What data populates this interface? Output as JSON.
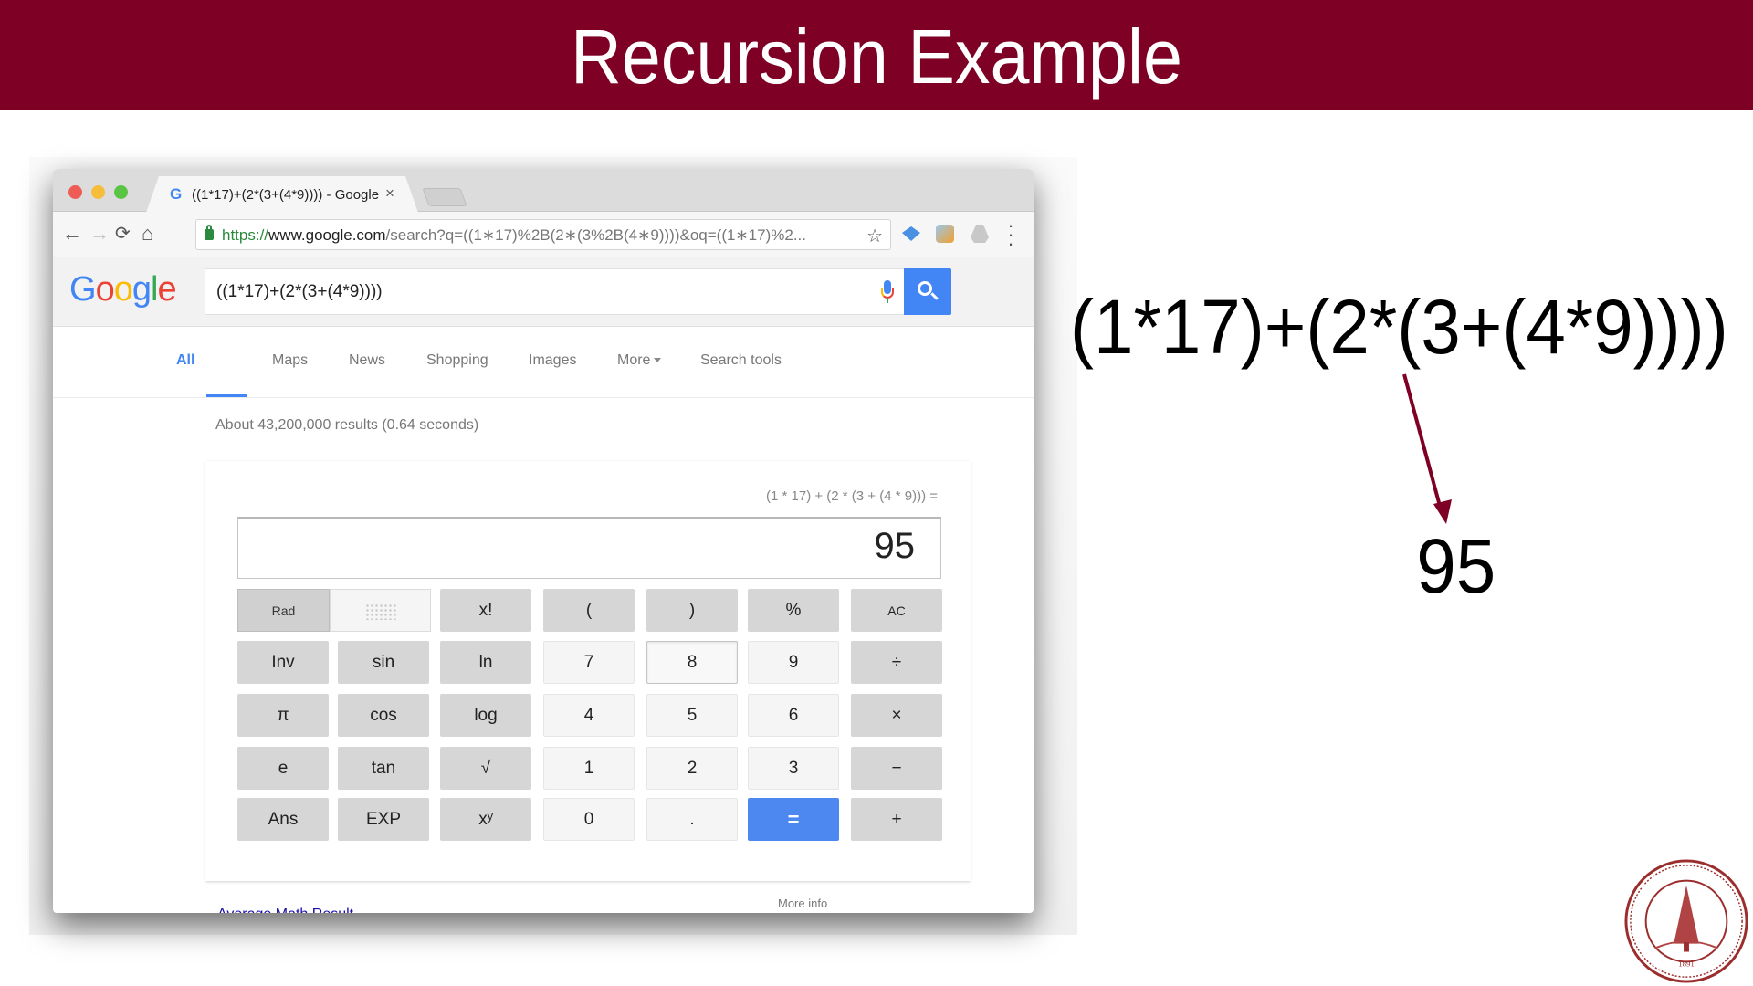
{
  "slide": {
    "title": "Recursion Example",
    "accent_color": "#7e0025"
  },
  "browser": {
    "tab": {
      "favicon": "G",
      "title": "((1*17)+(2*(3+(4*9)))) - Google S",
      "close": "×"
    },
    "toolbar": {
      "back": "←",
      "forward": "→",
      "reload": "⟳",
      "home": "⌂",
      "url_scheme": "https://",
      "url_host": "www.google.com",
      "url_path": "/search?q=((1∗17)%2B(2∗(3%2B(4∗9))))&oq=((1∗17)%2...",
      "star": "☆",
      "menu": "⋮",
      "extensions": [
        "graduation-cap-extension",
        "globe-extension",
        "drive-extension"
      ]
    }
  },
  "google": {
    "logo": [
      "G",
      "o",
      "o",
      "g",
      "l",
      "e"
    ],
    "query": "((1*17)+(2*(3+(4*9))))",
    "nav": [
      {
        "label": "All",
        "active": true
      },
      {
        "label": "Maps"
      },
      {
        "label": "News"
      },
      {
        "label": "Shopping"
      },
      {
        "label": "Images"
      },
      {
        "label": "More"
      },
      {
        "label": "Search tools"
      }
    ],
    "result_stats": "About 43,200,000 results (0.64 seconds)",
    "calculator": {
      "expression": "(1 * 17) + (2 * (3 + (4 * 9))) =",
      "result": "95",
      "angle_mode": "Rad",
      "keys": [
        [
          "x!",
          "(",
          ")",
          "%",
          "AC"
        ],
        [
          "Inv",
          "sin",
          "ln",
          "7",
          "8",
          "9",
          "÷"
        ],
        [
          "π",
          "cos",
          "log",
          "4",
          "5",
          "6",
          "×"
        ],
        [
          "e",
          "tan",
          "√",
          "1",
          "2",
          "3",
          "−"
        ],
        [
          "Ans",
          "EXP",
          "xʸ",
          "0",
          ".",
          "=",
          "+"
        ]
      ],
      "more_info": "More info"
    },
    "partial_link": "Average Math Result"
  },
  "annotation": {
    "equation": "(1*17)+(2*(3+(4*9))))",
    "result": "95",
    "arrow_color": "#7e0025"
  }
}
